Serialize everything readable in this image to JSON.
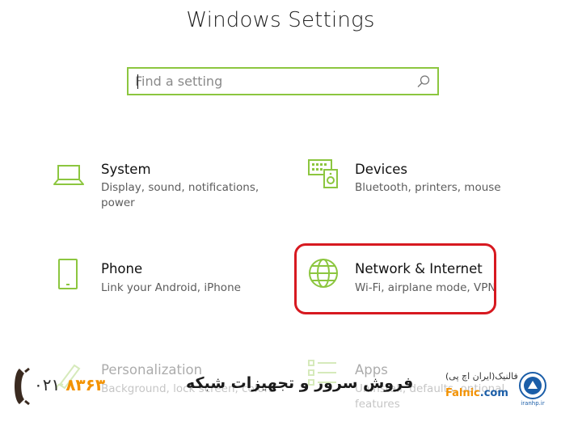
{
  "window": {
    "title": "Windows Settings"
  },
  "search": {
    "placeholder": "Find a setting"
  },
  "tiles": [
    {
      "name": "System",
      "desc_line1": "Display, sound, notifications,",
      "desc_line2": "power"
    },
    {
      "name": "Devices",
      "desc_line1": "Bluetooth, printers, mouse"
    },
    {
      "name": "Phone",
      "desc_line1": "Link your Android, iPhone"
    },
    {
      "name": "Network & Internet",
      "desc_line1": "Wi-Fi, airplane mode, VPN"
    },
    {
      "name": "Personalization",
      "desc_line1": "Background, lock screen, colors"
    },
    {
      "name": "Apps",
      "desc_line1": "Uninstall, defaults, optional",
      "desc_line2": "features"
    }
  ],
  "colors": {
    "accent": "#8cc63f",
    "highlight": "#d71920",
    "brand_orange": "#f39200",
    "brand_blue": "#1b5ea8"
  },
  "banner": {
    "text": "فروش سرور و تجهیزات شبکه",
    "phone_code": "۰۲۱",
    "phone_number": "۸۳۶۳",
    "brand_fa": "فالنیک(ایران اچ پی)",
    "brand_en_a": "Falnic",
    "brand_en_b": ".com",
    "seal_text": "iranhp.ir"
  },
  "icons": {
    "search": "search-icon",
    "system": "laptop-icon",
    "devices": "keyboard-speaker-icon",
    "phone": "phone-icon",
    "network": "globe-icon",
    "personalization": "brush-icon",
    "apps": "apps-list-icon",
    "telephone": "telephone-handset-icon"
  }
}
